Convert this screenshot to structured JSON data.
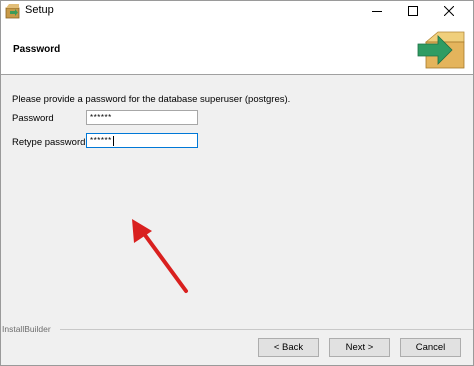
{
  "window": {
    "title": "Setup",
    "icon": "setup-box-icon",
    "controls": [
      "minimize-icon",
      "maximize-icon",
      "close-icon"
    ]
  },
  "header": {
    "title": "Password",
    "logo": "installer-box-arrow-icon"
  },
  "form": {
    "description": "Please provide a password for the database superuser (postgres).",
    "password_label": "Password",
    "password_value": "******",
    "retype_label": "Retype password",
    "retype_value": "******"
  },
  "annotation": {
    "arrow_color": "#d9201f"
  },
  "footer": {
    "brand": "InstallBuilder",
    "back_label": "< Back",
    "next_label": "Next >",
    "cancel_label": "Cancel"
  },
  "colors": {
    "title_bar": "#ffffff",
    "dialog_bg": "#f0f0f0",
    "button_bg": "#e1e1e1"
  }
}
